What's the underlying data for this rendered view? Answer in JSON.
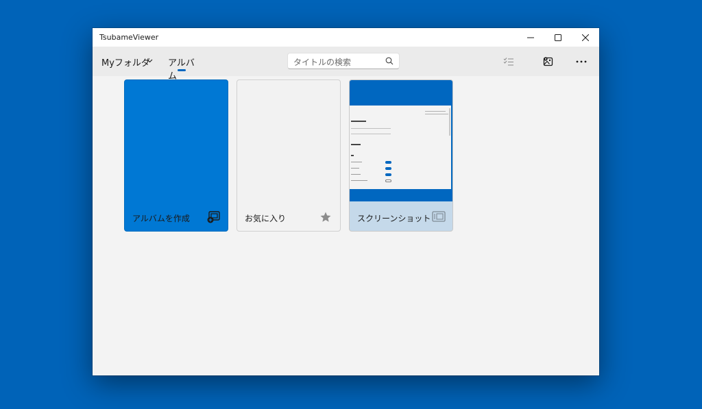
{
  "window": {
    "title": "TsubameViewer"
  },
  "toolbar": {
    "folder_label": "Myフォルダ",
    "album_tab_label": "アルバム",
    "search_placeholder": "タイトルの検索"
  },
  "cards": [
    {
      "label": "アルバムを作成",
      "icon": "add-album-icon"
    },
    {
      "label": "お気に入り",
      "icon": "star-icon"
    },
    {
      "label": "スクリーンショット",
      "icon": "screenshot-icon"
    }
  ],
  "colors": {
    "desktop": "#0063b8",
    "accent": "#0078d4",
    "window_bg": "#f3f3f3",
    "toolbar_bg": "#ebebeb"
  }
}
